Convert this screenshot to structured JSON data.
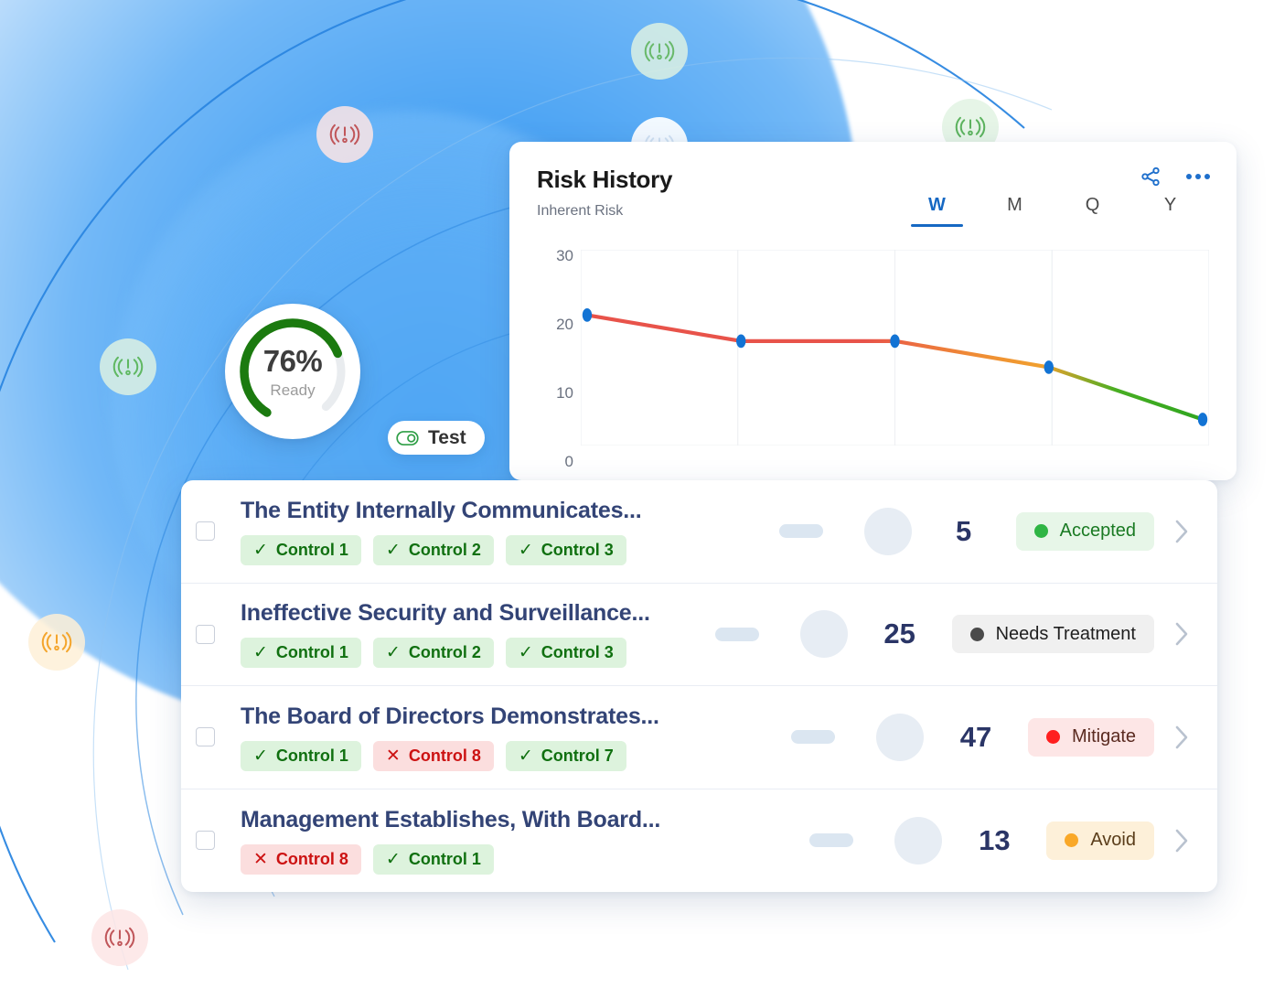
{
  "gauge": {
    "percent_label": "76%",
    "status_label": "Ready",
    "value": 76,
    "arc_color": "#1b7a0f",
    "track_color": "#e9ecef"
  },
  "test_pill": {
    "label": "Test",
    "icon": "toggle-on-icon",
    "icon_color": "#2e9e46"
  },
  "nodes": [
    {
      "id": "node-top-center",
      "icon": "risk-signal-icon",
      "color": "#69b96b",
      "variant": "green"
    },
    {
      "id": "node-top-left",
      "icon": "risk-signal-icon",
      "color": "#c0565a",
      "variant": "red"
    },
    {
      "id": "node-top-right",
      "icon": "risk-signal-icon",
      "color": "#5cb35e",
      "variant": "green"
    },
    {
      "id": "node-mid-left",
      "icon": "risk-signal-icon",
      "color": "#5fb862",
      "variant": "green"
    },
    {
      "id": "node-left-lower",
      "icon": "risk-signal-icon",
      "color": "#f4a52c",
      "variant": "orange"
    },
    {
      "id": "node-bottom-left",
      "icon": "risk-signal-icon",
      "color": "#c0565a",
      "variant": "red"
    },
    {
      "id": "node-behind-card",
      "icon": "risk-signal-icon",
      "color": "#ffffff",
      "variant": "white"
    }
  ],
  "risk_card": {
    "title": "Risk History",
    "subtitle": "Inherent Risk",
    "share_icon": "share-icon",
    "more_icon": "more-options-icon",
    "tabs": [
      {
        "label": "W",
        "active": true
      },
      {
        "label": "M",
        "active": false
      },
      {
        "label": "Q",
        "active": false
      },
      {
        "label": "Y",
        "active": false
      }
    ]
  },
  "chart_data": {
    "type": "line",
    "title": "Risk History",
    "subtitle": "Inherent Risk",
    "xlabel": "",
    "ylabel": "",
    "ylim": [
      0,
      30
    ],
    "ytick_labels": [
      "30",
      "20",
      "10",
      "0"
    ],
    "yticks": [
      30,
      20,
      10,
      0
    ],
    "x": [
      0,
      1,
      2,
      3,
      4
    ],
    "grid": true,
    "grid_columns": 4,
    "series": [
      {
        "name": "Inherent Risk",
        "values": [
          20,
          16,
          16,
          12,
          4
        ],
        "marker_color": "#1273d4",
        "line_gradient": [
          "#e8534a",
          "#e8534a",
          "#e8534a",
          "#f0a02e",
          "#3aab22"
        ]
      }
    ],
    "legend": false
  },
  "risk_list": {
    "rows": [
      {
        "title": "The Entity Internally Communicates...",
        "checked": false,
        "controls": [
          {
            "label": "Control 1",
            "state": "pass"
          },
          {
            "label": "Control 2",
            "state": "pass"
          },
          {
            "label": "Control 3",
            "state": "pass"
          }
        ],
        "score": "5",
        "status": "Accepted",
        "status_color": "#2fb544",
        "status_bg": "#e7f6e8",
        "status_text_color": "#1a7a23"
      },
      {
        "title": "Ineffective Security and Surveillance...",
        "checked": false,
        "controls": [
          {
            "label": "Control 1",
            "state": "pass"
          },
          {
            "label": "Control 2",
            "state": "pass"
          },
          {
            "label": "Control 3",
            "state": "pass"
          }
        ],
        "score": "25",
        "status": "Needs Treatment",
        "status_color": "#4a4a4a",
        "status_bg": "#f0f0f0",
        "status_text_color": "#1f1f1f"
      },
      {
        "title": "The Board of Directors Demonstrates...",
        "checked": false,
        "controls": [
          {
            "label": "Control 1",
            "state": "pass"
          },
          {
            "label": "Control 8",
            "state": "fail"
          },
          {
            "label": "Control 7",
            "state": "pass"
          }
        ],
        "score": "47",
        "status": "Mitigate",
        "status_color": "#ff1f1f",
        "status_bg": "#fde6e6",
        "status_text_color": "#5a2a20"
      },
      {
        "title": "Management Establishes, With Board...",
        "checked": false,
        "controls": [
          {
            "label": "Control 8",
            "state": "fail"
          },
          {
            "label": "Control 1",
            "state": "pass"
          }
        ],
        "score": "13",
        "status": "Avoid",
        "status_color": "#f9a828",
        "status_bg": "#fdf0d9",
        "status_text_color": "#5a3d1a"
      }
    ],
    "chevron_icon": "chevron-right-icon",
    "checkbox_icon": "checkbox-icon",
    "pass_icon": "check-icon",
    "fail_icon": "cross-icon"
  }
}
